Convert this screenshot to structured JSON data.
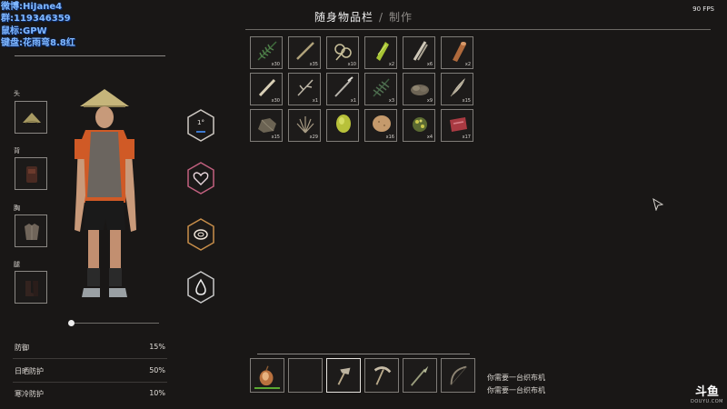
{
  "overlay": {
    "weibo": "微博:HiJane4",
    "qun": "群:119346359",
    "mouse": "鼠标:GPW",
    "keyboard": "键盘:花雨弯8.8红"
  },
  "fps": "90 FPS",
  "header": {
    "tab_inventory": "随身物品栏",
    "separator": "/",
    "tab_crafting": "制作"
  },
  "equipment": {
    "head_label": "头",
    "back_label": "背",
    "chest_label": "胸",
    "legs_label": "腿",
    "head_icon": "straw-hat-icon",
    "back_icon": "backpack-icon",
    "chest_icon": "leaf-vest-icon",
    "legs_icon": "boots-icon"
  },
  "stats": [
    {
      "icon": "temperature-icon",
      "text": "1°",
      "accent": "#3d7ad1"
    },
    {
      "icon": "heart-icon",
      "accent": "#c2607f"
    },
    {
      "icon": "food-icon",
      "accent": "#c98f4a"
    },
    {
      "icon": "water-drop-icon",
      "accent": "#c9c9c9"
    }
  ],
  "protection": [
    {
      "name": "防御",
      "value": "15%"
    },
    {
      "name": "日晒防护",
      "value": "50%"
    },
    {
      "name": "寒冷防护",
      "value": "10%"
    }
  ],
  "inventory": {
    "items": [
      {
        "icon": "fern-icon",
        "count": "x30"
      },
      {
        "icon": "stick-icon",
        "count": "x35"
      },
      {
        "icon": "rope-icon",
        "count": "x10"
      },
      {
        "icon": "fiber-bundle-icon",
        "count": "x2"
      },
      {
        "icon": "bamboo-icon",
        "count": "x6"
      },
      {
        "icon": "log-icon",
        "count": "x2"
      },
      {
        "icon": "bone-icon",
        "count": "x30"
      },
      {
        "icon": "twig-icon",
        "count": "x1"
      },
      {
        "icon": "spear-shaft-icon",
        "count": "x1"
      },
      {
        "icon": "palm-leaf-icon",
        "count": "x3"
      },
      {
        "icon": "stone-pile-icon",
        "count": "x9"
      },
      {
        "icon": "feather-icon",
        "count": "x15"
      },
      {
        "icon": "rock-icon",
        "count": "x15"
      },
      {
        "icon": "grass-icon",
        "count": "x29"
      },
      {
        "icon": "coconut-icon",
        "count": ""
      },
      {
        "icon": "potato-icon",
        "count": "x16"
      },
      {
        "icon": "herb-icon",
        "count": "x4"
      },
      {
        "icon": "raw-meat-icon",
        "count": "x17"
      }
    ]
  },
  "crafting": {
    "items": [
      {
        "icon": "torch-icon"
      },
      {
        "icon": "empty-slot"
      },
      {
        "icon": "stone-axe-icon"
      },
      {
        "icon": "pickaxe-icon"
      },
      {
        "icon": "spear-icon"
      },
      {
        "icon": "bow-icon"
      }
    ],
    "messages": [
      "你需要一台织布机",
      "你需要一台织布机"
    ]
  },
  "logo": {
    "main": "斗鱼",
    "sub": "DOUYU.COM"
  }
}
